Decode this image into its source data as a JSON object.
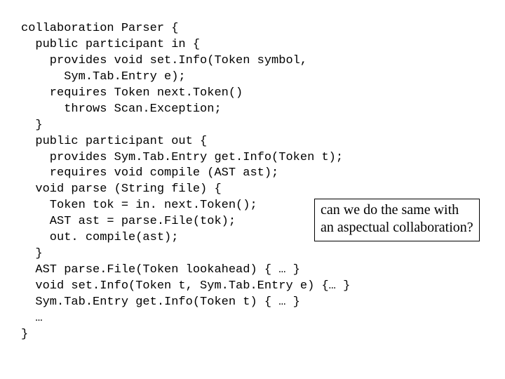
{
  "code": {
    "l1": "collaboration Parser {",
    "l2": "  public participant in {",
    "l3": "    provides void set.Info(Token symbol,",
    "l4": "      Sym.Tab.Entry e);",
    "l5": "    requires Token next.Token()",
    "l6": "      throws Scan.Exception;",
    "l7": "  }",
    "l8": "  public participant out {",
    "l9": "    provides Sym.Tab.Entry get.Info(Token t);",
    "l10": "    requires void compile (AST ast);",
    "l11": "  void parse (String file) {",
    "l12": "    Token tok = in. next.Token();",
    "l13": "    AST ast = parse.File(tok);",
    "l14": "    out. compile(ast);",
    "l15": "  }",
    "l16": "  AST parse.File(Token lookahead) { … }",
    "l17": "  void set.Info(Token t, Sym.Tab.Entry e) {… }",
    "l18": "  Sym.Tab.Entry get.Info(Token t) { … }",
    "l19": "  …",
    "l20": "}"
  },
  "callout": {
    "text": "can we do the same with an aspectual collaboration?"
  }
}
